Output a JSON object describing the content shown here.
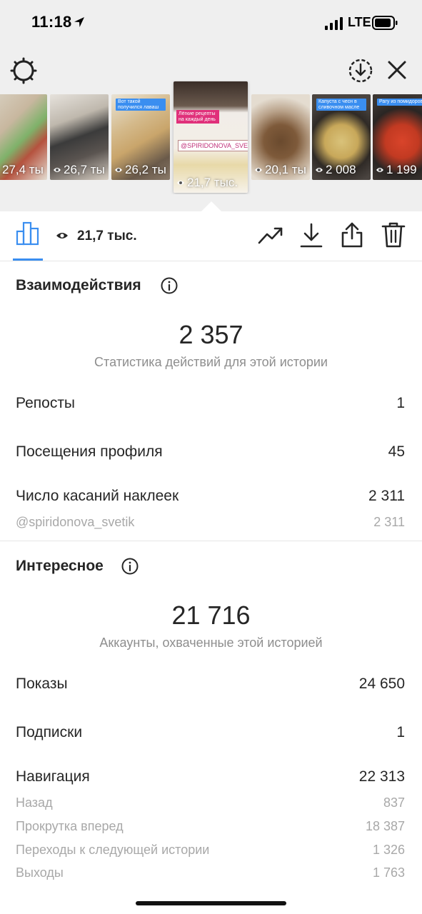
{
  "status_bar": {
    "time": "11:18",
    "network": "LTE"
  },
  "stories": [
    {
      "count": "27,4 ты",
      "caption": ""
    },
    {
      "count": "26,7 ты",
      "caption": ""
    },
    {
      "count": "26,2 ты",
      "caption": "Вот такой получился лаваш"
    },
    {
      "count": "21,7 тыс.",
      "caption": "Лёгкие рецепты на каждый день",
      "sticker": "@SPIRIDONOVA_SVETIK",
      "active": true
    },
    {
      "count": "20,1 ты",
      "caption": ""
    },
    {
      "count": "2 008",
      "caption": "Капуста с чесн в сливочном масле"
    },
    {
      "count": "1 199",
      "caption": "Рагу из помидоров"
    }
  ],
  "active_story": {
    "view_count": "21,7 тыс."
  },
  "interactions": {
    "title": "Взаимодействия",
    "total": "2 357",
    "caption": "Статистика действий для этой истории",
    "rows": [
      {
        "label": "Репосты",
        "value": "1"
      },
      {
        "label": "Посещения профиля",
        "value": "45"
      },
      {
        "label": "Число касаний наклеек",
        "value": "2 311"
      }
    ],
    "sub_rows": [
      {
        "label": "@spiridonova_svetik",
        "value": "2 311"
      }
    ]
  },
  "discovery": {
    "title": "Интересное",
    "total": "21 716",
    "caption": "Аккаунты, охваченные этой историей",
    "rows": [
      {
        "label": "Показы",
        "value": "24 650"
      },
      {
        "label": "Подписки",
        "value": "1"
      },
      {
        "label": "Навигация",
        "value": "22 313"
      }
    ],
    "sub_rows": [
      {
        "label": "Назад",
        "value": "837"
      },
      {
        "label": "Прокрутка вперед",
        "value": "18 387"
      },
      {
        "label": "Переходы к следующей истории",
        "value": "1 326"
      },
      {
        "label": "Выходы",
        "value": "1 763"
      }
    ]
  },
  "colors": {
    "accent": "#3a8ef0",
    "top_background": "#efefef",
    "muted_text": "#8e8e8e"
  }
}
